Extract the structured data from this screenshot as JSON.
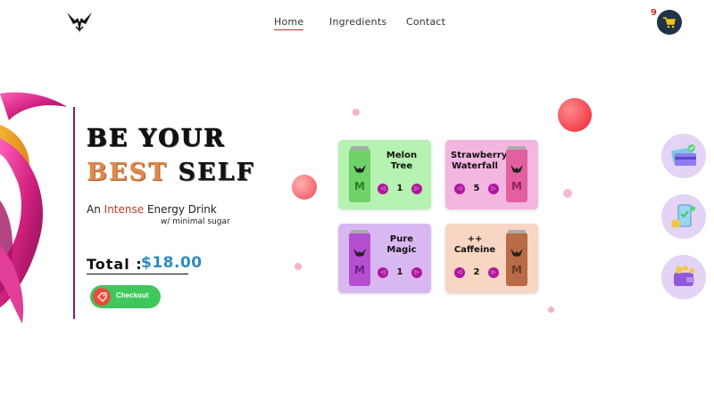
{
  "nav": {
    "home": "Home",
    "ingredients": "Ingredients",
    "contact": "Contact"
  },
  "cart": {
    "count": "9",
    "icon": "cart-icon"
  },
  "hero": {
    "line1": "BE YOUR",
    "best": "BEST",
    "self": "SELF",
    "tag_prefix": "An",
    "tag_highlight": "Intense",
    "tag_suffix": "Energy Drink",
    "subtag": "w/ minimal sugar",
    "total_label": "Total :",
    "total_value": "$18.00",
    "checkout_label": "Checkout"
  },
  "products": [
    {
      "name_line1": "Melon",
      "name_line2": "Tree",
      "qty": "1",
      "color": "#b6f2b1",
      "can_color": "#6fd36a"
    },
    {
      "name_line1": "Strawberry",
      "name_line2": "Waterfall",
      "qty": "5",
      "color": "#f3b6e0",
      "can_color": "#e2609f"
    },
    {
      "name_line1": "Pure",
      "name_line2": "Magic",
      "qty": "1",
      "color": "#d9b8f2",
      "can_color": "#b44fd1"
    },
    {
      "name_line1": "++",
      "name_line2": "Caffeine",
      "qty": "2",
      "color": "#f8d6c3",
      "can_color": "#b96b46"
    }
  ],
  "colors": {
    "accent": "#b0179e",
    "total": "#2e8bc0",
    "checkout": "#3ec75a",
    "cart_bg": "#1f3347"
  }
}
